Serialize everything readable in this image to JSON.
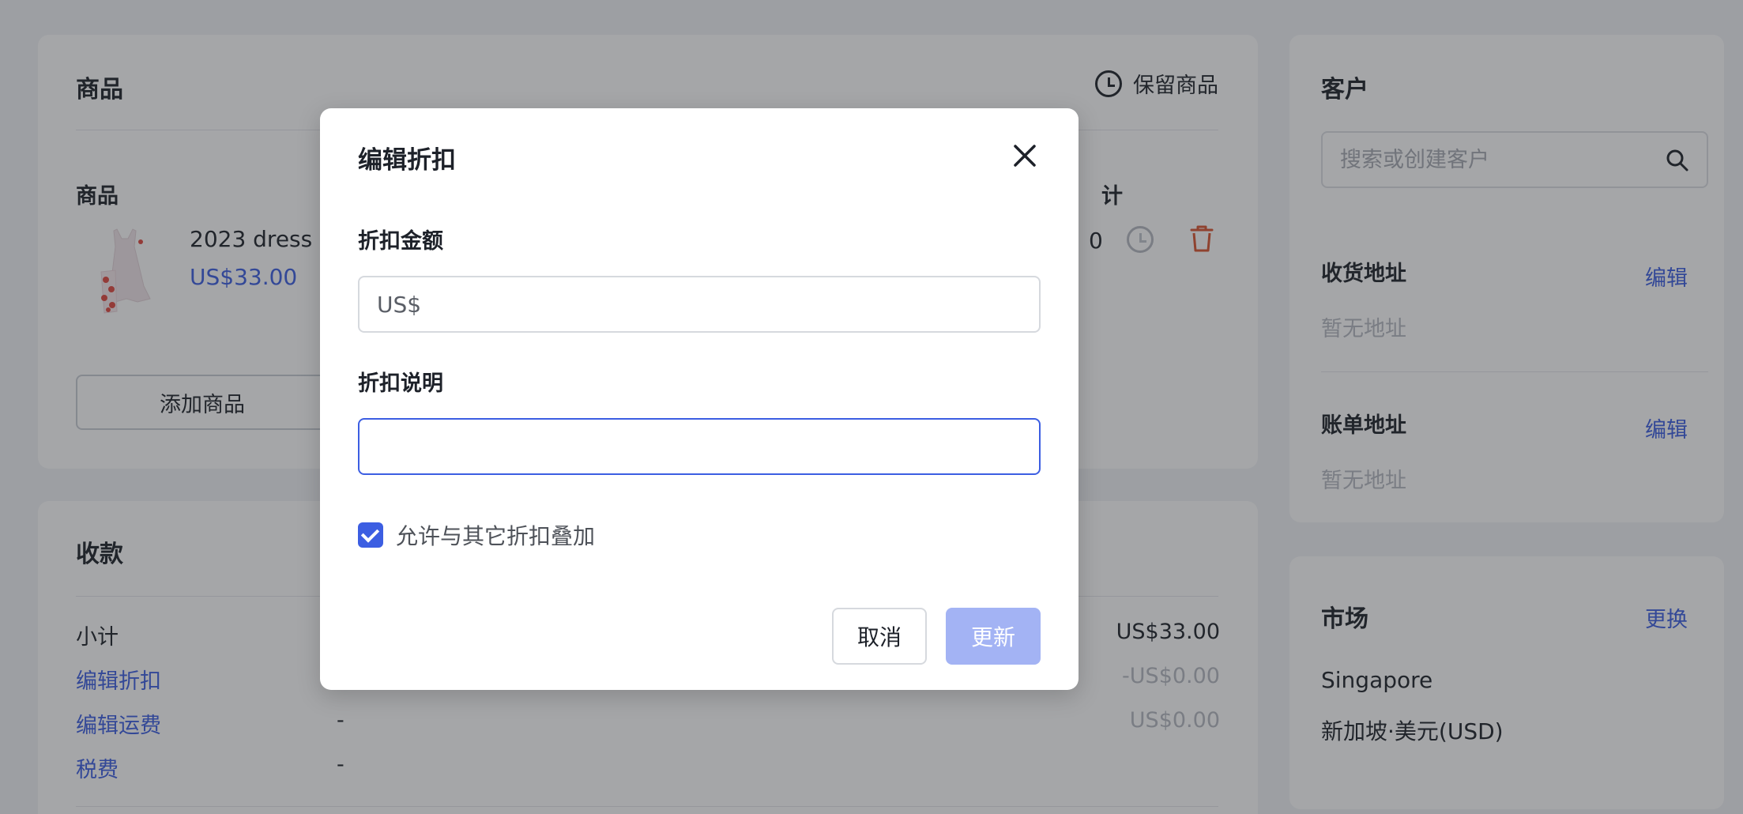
{
  "products": {
    "title": "商品",
    "hold_label": "保留商品",
    "column_product": "商品",
    "column_total_partial": "计",
    "item": {
      "name": "2023 dress",
      "price": "US$33.00",
      "total_partial": "0"
    },
    "add_button": "添加商品"
  },
  "payments": {
    "title": "收款",
    "rows": [
      {
        "label": "小计",
        "middle": "",
        "value": "US$33.00"
      },
      {
        "label": "编辑折扣",
        "middle": "",
        "value": "-US$0.00"
      },
      {
        "label": "编辑运费",
        "middle": "-",
        "value": "US$0.00"
      },
      {
        "label": "税费",
        "middle": "-",
        "value": ""
      }
    ]
  },
  "customer": {
    "title": "客户",
    "search_placeholder": "搜索或创建客户",
    "shipping_title": "收货地址",
    "shipping_edit": "编辑",
    "shipping_empty": "暂无地址",
    "billing_title": "账单地址",
    "billing_edit": "编辑",
    "billing_empty": "暂无地址"
  },
  "market": {
    "title": "市场",
    "change": "更换",
    "country": "Singapore",
    "currency": "新加坡·美元(USD)"
  },
  "modal": {
    "title": "编辑折扣",
    "amount_label": "折扣金额",
    "amount_placeholder": "US$",
    "description_label": "折扣说明",
    "description_value": "",
    "stack_label": "允许与其它折扣叠加",
    "stack_checked": true,
    "cancel": "取消",
    "update": "更新"
  },
  "colors": {
    "accent": "#3c5ee2",
    "update_disabled": "#a3b3f4",
    "delete": "#d9542f"
  },
  "icons": [
    "clock-icon",
    "trash-icon",
    "search-icon",
    "close-icon",
    "checkbox-checked-icon",
    "product-thumbnail"
  ]
}
